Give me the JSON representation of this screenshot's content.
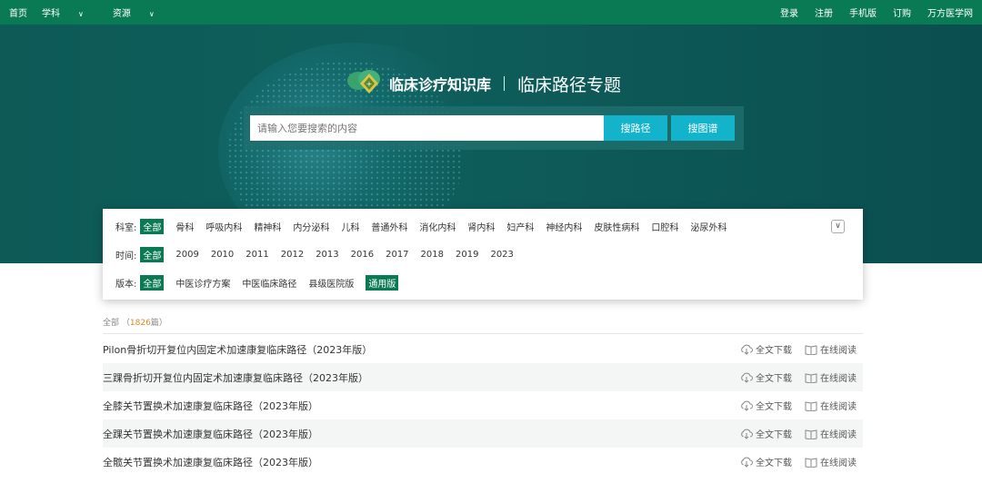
{
  "topnav": {
    "left": [
      "首页",
      "学科",
      "资源"
    ],
    "right": [
      "登录",
      "注册",
      "手机版",
      "订购",
      "万方医学网"
    ]
  },
  "hero": {
    "brand": "临床诊疗知识库",
    "subtitle": "临床路径专题",
    "search_placeholder": "请输入您要搜索的内容",
    "btn_path": "搜路径",
    "btn_graph": "搜图谱"
  },
  "filters": {
    "dept_label": "科室:",
    "depts": [
      "全部",
      "骨科",
      "呼吸内科",
      "精神科",
      "内分泌科",
      "儿科",
      "普通外科",
      "消化内科",
      "肾内科",
      "妇产科",
      "神经内科",
      "皮肤性病科",
      "口腔科",
      "泌尿外科"
    ],
    "time_label": "时间:",
    "years": [
      "全部",
      "2009",
      "2010",
      "2011",
      "2012",
      "2013",
      "2016",
      "2017",
      "2018",
      "2019",
      "2023"
    ],
    "version_label": "版本:",
    "versions": [
      "全部",
      "中医诊疗方案",
      "中医临床路径",
      "县级医院版",
      "通用版"
    ]
  },
  "results": {
    "all_label": "全部",
    "count": "1826",
    "unit": "篇",
    "download_label": "全文下载",
    "read_label": "在线阅读",
    "items": [
      "Pilon骨折切开复位内固定术加速康复临床路径（2023年版）",
      "三踝骨折切开复位内固定术加速康复临床路径（2023年版）",
      "全膝关节置换术加速康复临床路径（2023年版）",
      "全踝关节置换术加速康复临床路径（2023年版）",
      "全髋关节置换术加速康复临床路径（2023年版）"
    ]
  },
  "colors": {
    "topbar": "#0a7a55",
    "hero": "#0f5f5c",
    "button": "#13b3cc",
    "accent": "#e08a1c"
  }
}
